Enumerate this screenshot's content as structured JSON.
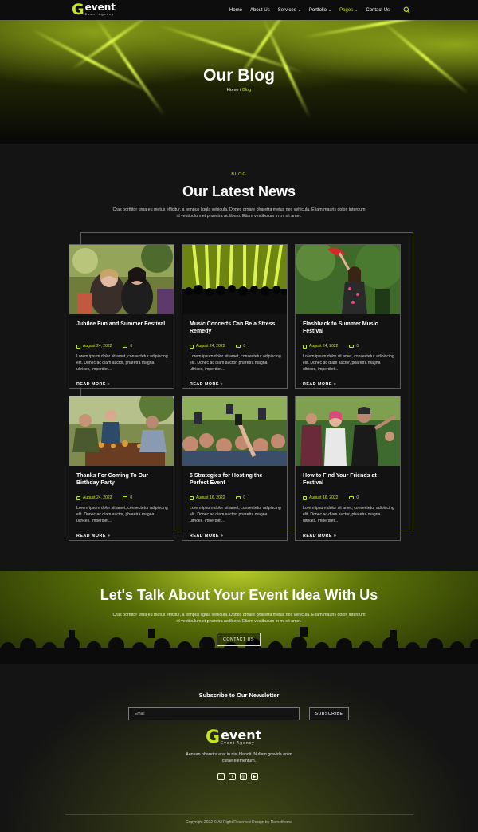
{
  "brand": {
    "logo_g": "G",
    "logo_word": "event",
    "tagline": "Event Agency",
    "accent": "#c7e51b"
  },
  "nav": {
    "items": [
      {
        "label": "Home",
        "dropdown": false,
        "active": false
      },
      {
        "label": "About Us",
        "dropdown": false,
        "active": false
      },
      {
        "label": "Services",
        "dropdown": true,
        "active": false
      },
      {
        "label": "Portfolio",
        "dropdown": true,
        "active": false
      },
      {
        "label": "Pages",
        "dropdown": true,
        "active": true
      },
      {
        "label": "Contact Us",
        "dropdown": false,
        "active": false
      }
    ],
    "search_icon": "search-icon"
  },
  "hero": {
    "title": "Our Blog",
    "crumb_home": "Home",
    "crumb_sep": " / ",
    "crumb_current": "Blog"
  },
  "blog": {
    "kicker": "BLOG",
    "title": "Our Latest News",
    "description": "Cras porttitor urna eu metus efficitur, a tempus ligula vehicula. Donec ornare pharetra metus nec vehicula. Etiam mauris dolor, interdum id vestibulum et pharetra ac libero. Etiam vestibulum in mi sit amet.",
    "posts": [
      {
        "title": "Jubilee Fun and Summer Festival",
        "date": "August 24, 2022",
        "comments": "0",
        "excerpt": "Lorem ipsum dolor sit amet, consectetur adipiscing elit. Donec ac diam auctor, pharetra magna ultrices, imperdiet...",
        "more": "READ MORE"
      },
      {
        "title": "Music Concerts Can Be a Stress Remedy",
        "date": "August 24, 2022",
        "comments": "0",
        "excerpt": "Lorem ipsum dolor sit amet, consectetur adipiscing elit. Donec ac diam auctor, pharetra magna ultrices, imperdiet...",
        "more": "READ MORE"
      },
      {
        "title": "Flashback to Summer Music Festival",
        "date": "August 24, 2022",
        "comments": "0",
        "excerpt": "Lorem ipsum dolor sit amet, consectetur adipiscing elit. Donec ac diam auctor, pharetra magna ultrices, imperdiet...",
        "more": "READ MORE"
      },
      {
        "title": "Thanks For Coming To Our Birthday Party",
        "date": "August 24, 2022",
        "comments": "0",
        "excerpt": "Lorem ipsum dolor sit amet, consectetur adipiscing elit. Donec ac diam auctor, pharetra magna ultrices, imperdiet...",
        "more": "READ MORE"
      },
      {
        "title": "6 Strategies for Hosting the Perfect Event",
        "date": "August 16, 2022",
        "comments": "0",
        "excerpt": "Lorem ipsum dolor sit amet, consectetur adipiscing elit. Donec ac diam auctor, pharetra magna ultrices, imperdiet...",
        "more": "READ MORE"
      },
      {
        "title": "How to Find Your Friends at Festival",
        "date": "August 16, 2022",
        "comments": "0",
        "excerpt": "Lorem ipsum dolor sit amet, consectetur adipiscing elit. Donec ac diam auctor, pharetra magna ultrices, imperdiet...",
        "more": "READ MORE"
      }
    ]
  },
  "cta": {
    "title": "Let's Talk About Your Event Idea With Us",
    "description": "Cras porttitor urna eu metus efficitur, a tempus ligula vehicula. Donec ornare pharetra metus nec vehicula. Etiam mauris dolor, interdum id vestibulum et pharetra ac libero. Etiam vestibulum in mi sit amet.",
    "button": "CONTACT US"
  },
  "footer": {
    "newsletter_title": "Subscribe to Our Newsletter",
    "email_placeholder": "Email",
    "subscribe": "SUBSCRIBE",
    "description": "Aenean pharetra erat in nisi blandit. Nullam gravida enim curae elementum.",
    "socials": [
      "facebook-icon",
      "twitter-icon",
      "instagram-icon",
      "youtube-icon"
    ],
    "copyright": "Copyright 2022 © All Right Reserved Design by Rometheme"
  }
}
